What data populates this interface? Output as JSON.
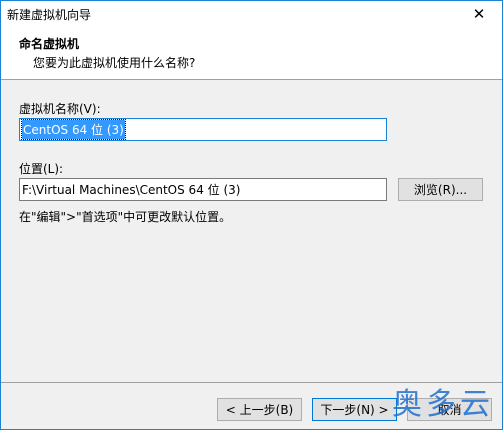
{
  "window": {
    "title": "新建虚拟机向导",
    "close_glyph": "✕"
  },
  "header": {
    "title": "命名虚拟机",
    "subtitle": "您要为此虚拟机使用什么名称?"
  },
  "form": {
    "vm_name_label": "虚拟机名称(V):",
    "vm_name_value": "CentOS 64 位 (3)",
    "location_label": "位置(L):",
    "location_value": "F:\\Virtual Machines\\CentOS 64 位 (3)",
    "browse_label": "浏览(R)...",
    "hint": "在\"编辑\">\"首选项\"中可更改默认位置。"
  },
  "footer": {
    "back_label": "< 上一步(B)",
    "next_label": "下一步(N) >",
    "cancel_label": "取消"
  },
  "watermark": "奥多云",
  "colors": {
    "accent": "#1883d7",
    "selection": "#3399ff",
    "panel": "#f0f0f0",
    "watermark": "#1f6fd0"
  }
}
